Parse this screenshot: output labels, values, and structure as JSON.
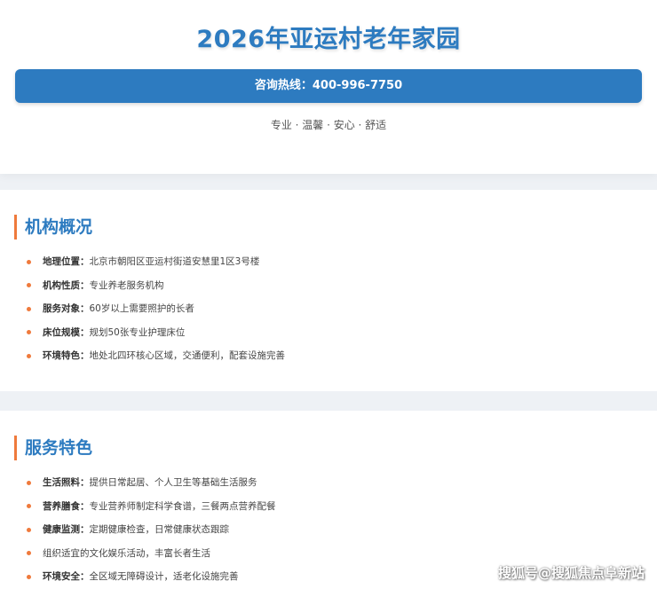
{
  "header": {
    "title": "2026年亚运村老年家园",
    "hotline": "咨询热线：400-996-7750",
    "slogan": "专业 · 温馨 · 安心 · 舒适"
  },
  "overview": {
    "title": "机构概况",
    "items": [
      {
        "label": "地理位置：",
        "text": "北京市朝阳区亚运村街道安慧里1区3号楼"
      },
      {
        "label": "机构性质：",
        "text": "专业养老服务机构"
      },
      {
        "label": "服务对象：",
        "text": "60岁以上需要照护的长者"
      },
      {
        "label": "床位规模：",
        "text": "规划50张专业护理床位"
      },
      {
        "label": "环境特色：",
        "text": "地处北四环核心区域，交通便利，配套设施完善"
      }
    ]
  },
  "services": {
    "title": "服务特色",
    "items": [
      {
        "label": "生活照料：",
        "text": "提供日常起居、个人卫生等基础生活服务"
      },
      {
        "label": "营养膳食：",
        "text": "专业营养师制定科学食谱，三餐两点营养配餐"
      },
      {
        "label": "健康监测：",
        "text": "定期健康检查，日常健康状态跟踪"
      },
      {
        "label": "",
        "text": "组织适宜的文化娱乐活动，丰富长者生活"
      },
      {
        "label": "环境安全：",
        "text": "全区域无障碍设计，适老化设施完善"
      }
    ]
  },
  "watermark": "搜狐号@搜狐焦点阜新站",
  "colors": {
    "accent_blue": "#2d7bc0",
    "accent_orange": "#ef7a3c"
  }
}
